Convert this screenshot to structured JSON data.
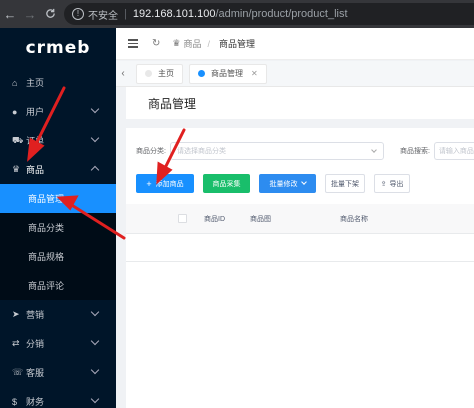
{
  "browser": {
    "back": "←",
    "forward": "→",
    "reload": "C",
    "security_icon": "info-circle-icon",
    "security_label": "不安全",
    "url_host": "192.168.101.100",
    "url_path": "/admin/product/product_list"
  },
  "sidebar": {
    "logo": "crmeb",
    "items": [
      {
        "label": "主页",
        "icon": "home-icon"
      },
      {
        "label": "用户",
        "icon": "user-icon"
      },
      {
        "label": "订单",
        "icon": "cart-icon"
      },
      {
        "label": "商品",
        "icon": "goods-icon"
      },
      {
        "label": "营销",
        "icon": "send-icon"
      },
      {
        "label": "分销",
        "icon": "share-icon"
      },
      {
        "label": "客服",
        "icon": "service-icon"
      },
      {
        "label": "财务",
        "icon": "money-icon"
      }
    ],
    "submenu": [
      "商品管理",
      "商品分类",
      "商品规格",
      "商品评论"
    ]
  },
  "header": {
    "breadcrumb_root": "商品",
    "breadcrumb_current": "商品管理"
  },
  "tabs": [
    {
      "label": "主页"
    },
    {
      "label": "商品管理"
    }
  ],
  "page": {
    "title": "商品管理"
  },
  "filters": {
    "category_label": "商品分类:",
    "category_placeholder": "请选择商品分类",
    "search_label": "商品搜索:",
    "search_placeholder": "请输入商品名称/关键字/ID"
  },
  "actions": {
    "add": "添加商品",
    "collect": "商品采集",
    "batch_edit": "批量修改",
    "batch_offline": "批量下架",
    "export": "导出"
  },
  "table": {
    "columns": [
      "商品ID",
      "商品图",
      "商品名称"
    ]
  },
  "colors": {
    "sidebar_bg": "#001529",
    "accent": "#1890ff",
    "green": "#19be6b",
    "annotation_red": "#e02020"
  }
}
